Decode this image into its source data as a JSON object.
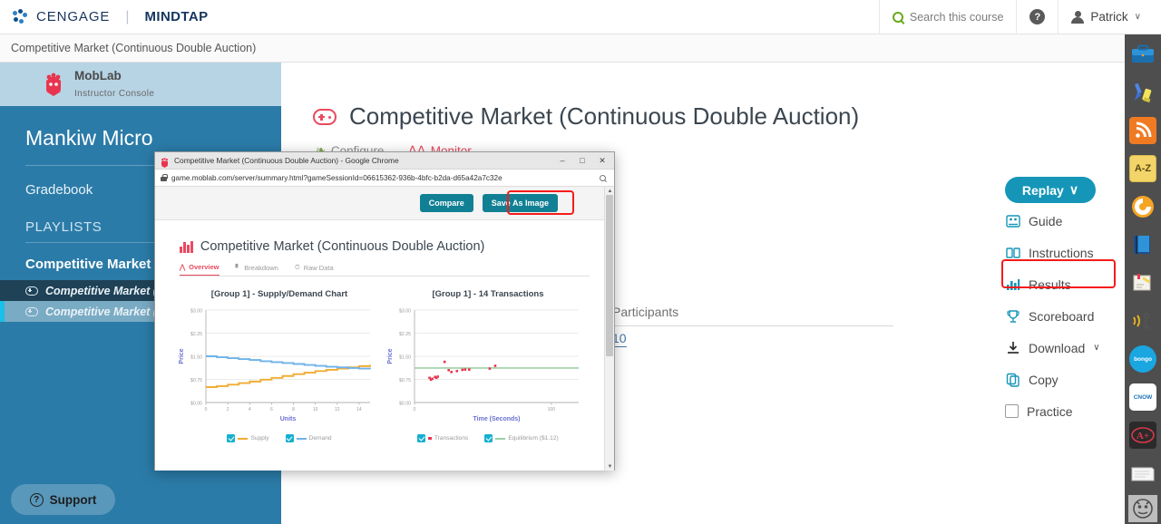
{
  "topbar": {
    "brand_primary": "CENGAGE",
    "brand_secondary": "MINDTAP",
    "search_label": "Search this course",
    "help_label": "?",
    "user_name": "Patrick",
    "caret": "∨"
  },
  "breadcrumb": {
    "title": "Competitive Market (Continuous Double Auction)",
    "close": "✕"
  },
  "leftnav": {
    "product_name": "MobLab",
    "product_sub": "Instructor Console",
    "course_title": "Mankiw Micro",
    "gradebook": "Gradebook",
    "playlists_header": "PLAYLISTS",
    "playlist_title": "Competitive Market (",
    "items": [
      {
        "label": "Competitive Market (Co",
        "state": "dark"
      },
      {
        "label": "Competitive Market (Co",
        "state": "selected"
      }
    ],
    "support": "Support"
  },
  "main": {
    "game_title": "Competitive Market (Continuous Double Auction)",
    "tabs": [
      {
        "label": "Configure",
        "active": false
      },
      {
        "label": "Monitor",
        "active": true
      }
    ],
    "participants_label": "Participants",
    "participants_count": "10"
  },
  "actions": {
    "replay": "Replay",
    "replay_caret": "∨",
    "items": [
      {
        "label": "Guide",
        "icon": "guide-icon"
      },
      {
        "label": "Instructions",
        "icon": "instructions-icon"
      },
      {
        "label": "Results",
        "icon": "results-bar-icon",
        "highlighted": true
      },
      {
        "label": "Scoreboard",
        "icon": "trophy-icon"
      },
      {
        "label": "Download",
        "icon": "download-icon",
        "caret": "∨"
      },
      {
        "label": "Copy",
        "icon": "copy-icon"
      },
      {
        "label": "Practice",
        "icon": "checkbox-icon"
      }
    ]
  },
  "rail": {
    "icons": [
      "briefcase-icon",
      "pen-highlighter-icon",
      "rss-icon",
      "a-z-dictionary-icon",
      "brainstorm-icon",
      "ebook-icon",
      "notepad-icon",
      "read-aloud-icon",
      "bongo-icon",
      "cnow-icon",
      "aplus-grade-icon",
      "flashcards-icon",
      "mindtap-app-icon"
    ],
    "az_label": "A-Z",
    "bongo_label": "bongo",
    "cnow_label": "CNOW",
    "aplus_label": "A+"
  },
  "chrome": {
    "window_title": "Competitive Market (Continuous Double Auction) - Google Chrome",
    "minimize": "–",
    "maximize": "□",
    "close": "✕",
    "url": "game.moblab.com/server/summary.html?gameSessionId=06615362-936b-4bfc-b2da-d65a42a7c32e",
    "compare_button": "Compare",
    "save_image_button": "Save As Image",
    "report_title": "Competitive Market (Continuous Double Auction)",
    "report_tabs": [
      {
        "label": "Overview",
        "active": true
      },
      {
        "label": "Breakdown",
        "active": false
      },
      {
        "label": "Raw Data",
        "active": false
      }
    ],
    "scroll_up": "▲",
    "scroll_down": "▼"
  },
  "colors": {
    "cengage_blue": "#16355e",
    "teal_button": "#1596b8",
    "chrome_button": "#128094",
    "highlight_red": "#f61a1a",
    "accent_red": "#e8495f",
    "supply_orange": "#f0ad34",
    "demand_blue": "#6fb3e8",
    "transaction_red": "#e8354e",
    "equilibrium_green": "#9ccfa5",
    "nav_blue": "#2b7ba8"
  },
  "chart_data": [
    {
      "type": "line",
      "title": "[Group 1] - Supply/Demand Chart",
      "xlabel": "Units",
      "ylabel": "Price",
      "xlim": [
        0,
        15
      ],
      "ylim": [
        0,
        3.0
      ],
      "yticks": [
        "$0.00",
        "$0.75",
        "$1.50",
        "$2.25",
        "$3.00"
      ],
      "xticks": [
        "0",
        "2",
        "4",
        "6",
        "8",
        "10",
        "12",
        "14"
      ],
      "grid": true,
      "legend_position": "bottom",
      "series": [
        {
          "name": "Supply",
          "color": "#f0ad34",
          "step": true,
          "x": [
            0,
            1,
            2,
            3,
            4,
            5,
            6,
            7,
            8,
            9,
            10,
            11,
            12,
            13,
            14,
            15
          ],
          "values": [
            0.5,
            0.53,
            0.58,
            0.63,
            0.68,
            0.74,
            0.8,
            0.86,
            0.92,
            0.97,
            1.02,
            1.06,
            1.1,
            1.14,
            1.18,
            1.22
          ]
        },
        {
          "name": "Demand",
          "color": "#6fb3e8",
          "step": true,
          "x": [
            0,
            1,
            2,
            3,
            4,
            5,
            6,
            7,
            8,
            9,
            10,
            11,
            12,
            13,
            14,
            15
          ],
          "values": [
            1.5,
            1.47,
            1.44,
            1.41,
            1.38,
            1.34,
            1.31,
            1.28,
            1.25,
            1.22,
            1.19,
            1.16,
            1.14,
            1.12,
            1.1,
            1.08
          ]
        }
      ]
    },
    {
      "type": "scatter",
      "title": "[Group 1] - 14 Transactions",
      "xlabel": "Time (Seconds)",
      "ylabel": "Price",
      "xlim": [
        0,
        120
      ],
      "ylim": [
        0,
        3.0
      ],
      "yticks": [
        "$0.00",
        "$0.75",
        "$1.50",
        "$2.25",
        "$3.00"
      ],
      "xticks": [
        "0",
        "100"
      ],
      "grid": true,
      "legend_position": "bottom",
      "equilibrium_price": 1.12,
      "equilibrium_label": "Equilibrium ($1.12)",
      "series": [
        {
          "name": "Transactions",
          "color": "#e8354e",
          "points": [
            [
              11,
              0.8
            ],
            [
              12,
              0.74
            ],
            [
              13,
              0.77
            ],
            [
              15,
              0.83
            ],
            [
              16,
              0.8
            ],
            [
              17,
              0.84
            ],
            [
              22,
              1.32
            ],
            [
              25,
              1.05
            ],
            [
              27,
              0.99
            ],
            [
              31,
              1.02
            ],
            [
              35,
              1.06
            ],
            [
              37,
              1.07
            ],
            [
              40,
              1.07
            ],
            [
              55,
              1.1
            ],
            [
              59,
              1.19
            ]
          ]
        }
      ]
    }
  ]
}
